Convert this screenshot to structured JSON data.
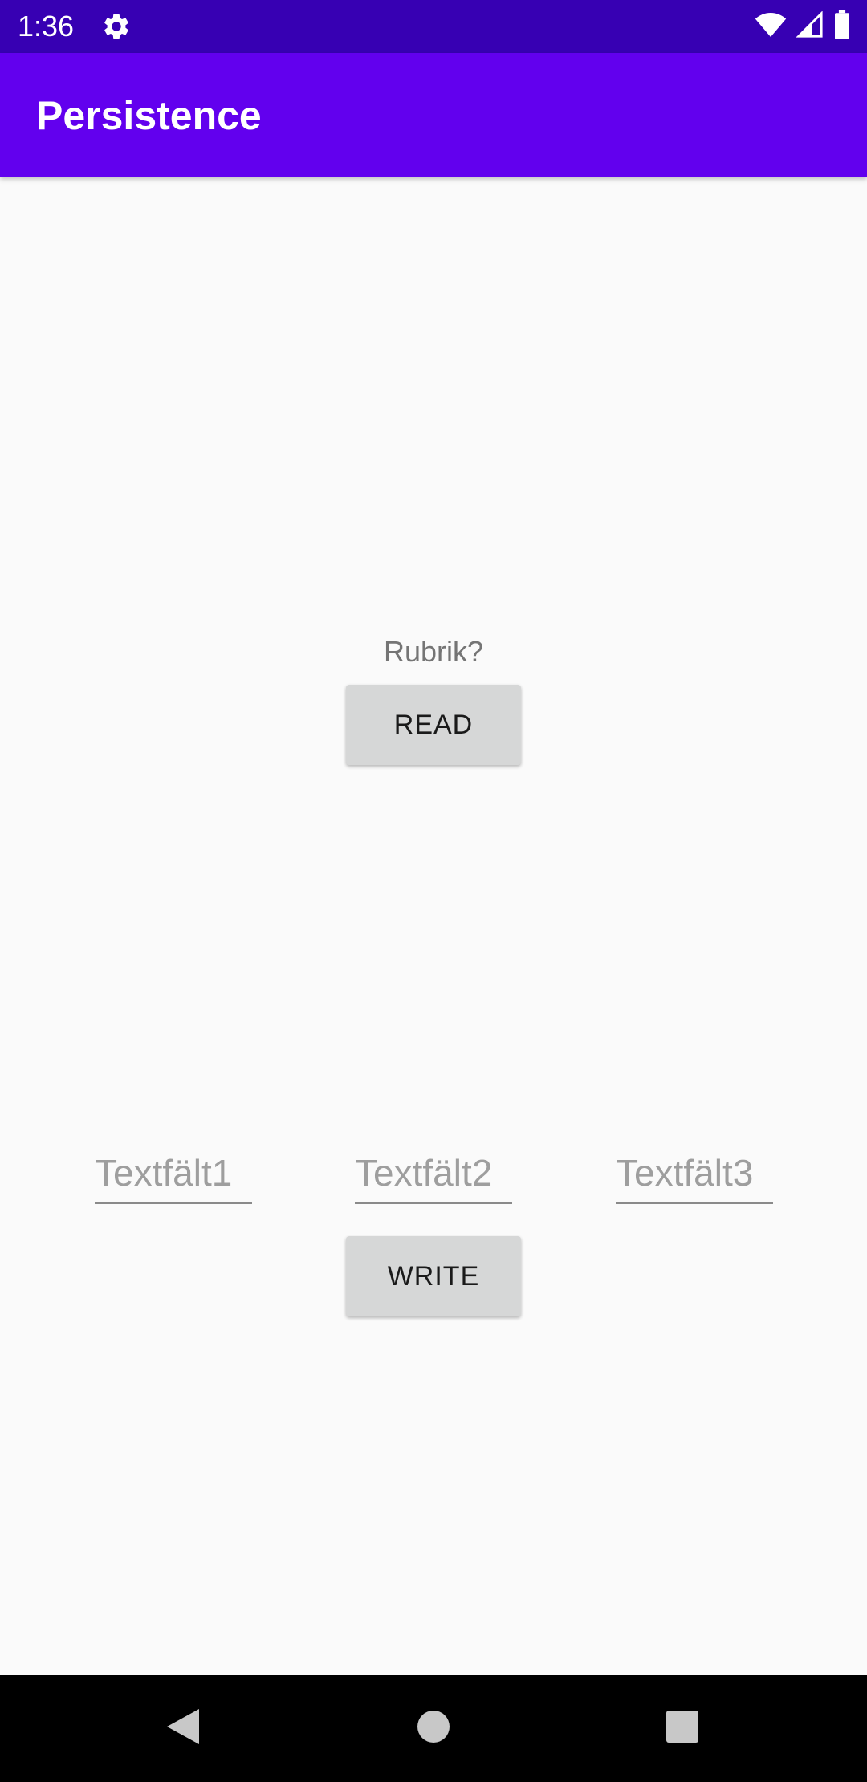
{
  "status_bar": {
    "time": "1:36",
    "icons": [
      "settings-gear-icon",
      "wifi-icon",
      "signal-icon",
      "battery-icon"
    ]
  },
  "app_bar": {
    "title": "Persistence",
    "color": "#6200ee"
  },
  "content": {
    "heading": "Rubrik?",
    "read_button": "READ",
    "write_button": "WRITE",
    "fields": [
      {
        "placeholder": "Textfält1",
        "value": ""
      },
      {
        "placeholder": "Textfält2",
        "value": ""
      },
      {
        "placeholder": "Textfält3",
        "value": ""
      }
    ]
  },
  "nav_bar": {
    "buttons": [
      "back-icon",
      "home-icon",
      "recents-icon"
    ]
  },
  "colors": {
    "status_bar": "#3700b3",
    "app_bar": "#6200ee",
    "button": "#d6d7d7",
    "background": "#fafafa"
  }
}
